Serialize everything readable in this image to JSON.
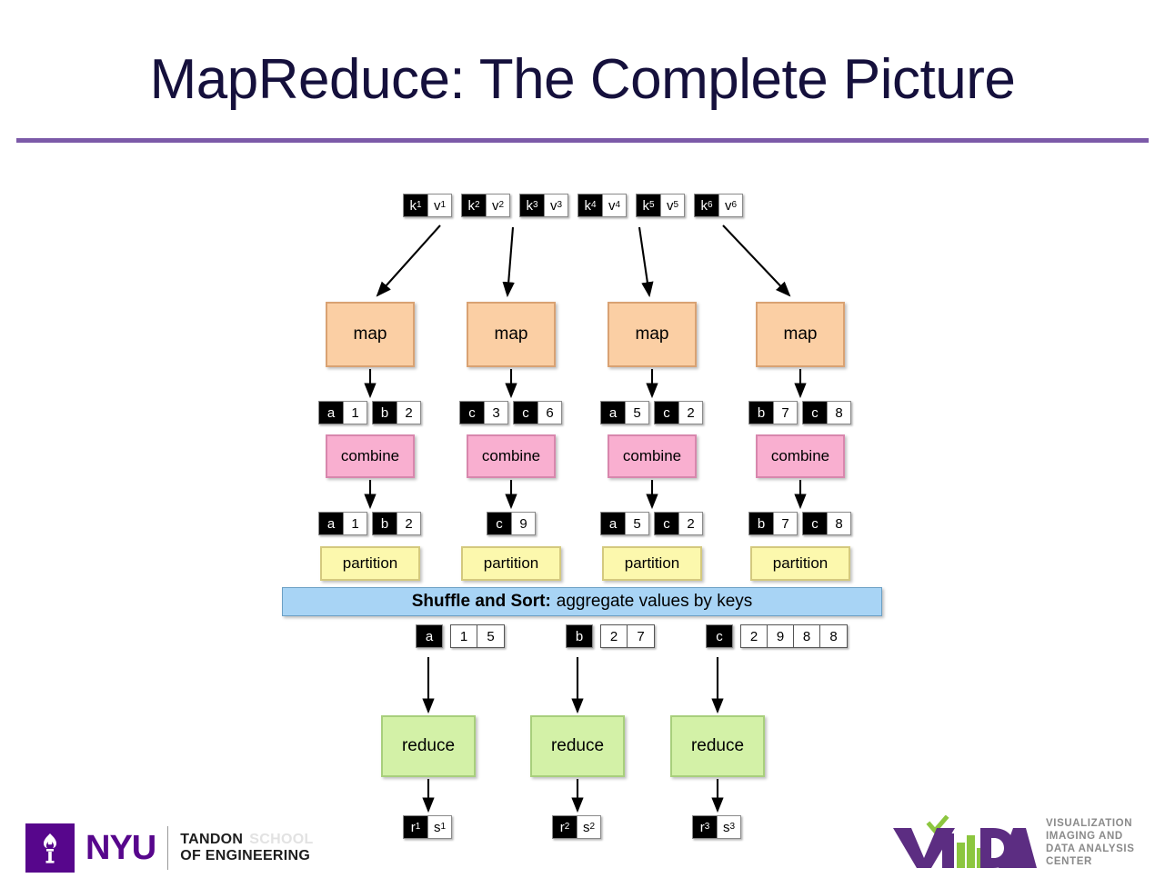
{
  "slide": {
    "title": "MapReduce: The Complete Picture",
    "title_color": "#15103c",
    "rule_color": "#7c5aa8"
  },
  "inputs": [
    {
      "k": "k",
      "ksub": "1",
      "v": "v",
      "vsub": "1"
    },
    {
      "k": "k",
      "ksub": "2",
      "v": "v",
      "vsub": "2"
    },
    {
      "k": "k",
      "ksub": "3",
      "v": "v",
      "vsub": "3"
    },
    {
      "k": "k",
      "ksub": "4",
      "v": "v",
      "vsub": "4"
    },
    {
      "k": "k",
      "ksub": "5",
      "v": "v",
      "vsub": "5"
    },
    {
      "k": "k",
      "ksub": "6",
      "v": "v",
      "vsub": "6"
    }
  ],
  "stages": {
    "map_label": "map",
    "combine_label": "combine",
    "partition_label": "partition",
    "reduce_label": "reduce"
  },
  "map_outputs": [
    [
      {
        "k": "a",
        "v": "1"
      },
      {
        "k": "b",
        "v": "2"
      }
    ],
    [
      {
        "k": "c",
        "v": "3"
      },
      {
        "k": "c",
        "v": "6"
      }
    ],
    [
      {
        "k": "a",
        "v": "5"
      },
      {
        "k": "c",
        "v": "2"
      }
    ],
    [
      {
        "k": "b",
        "v": "7"
      },
      {
        "k": "c",
        "v": "8"
      }
    ]
  ],
  "combine_outputs": [
    [
      {
        "k": "a",
        "v": "1"
      },
      {
        "k": "b",
        "v": "2"
      }
    ],
    [
      {
        "k": "c",
        "v": "9"
      }
    ],
    [
      {
        "k": "a",
        "v": "5"
      },
      {
        "k": "c",
        "v": "2"
      }
    ],
    [
      {
        "k": "b",
        "v": "7"
      },
      {
        "k": "c",
        "v": "8"
      }
    ]
  ],
  "shuffle": {
    "strong": "Shuffle and Sort:",
    "rest": "aggregate values by keys",
    "banner_color": "#a8d4f5"
  },
  "shuffle_outputs": [
    {
      "k": "a",
      "values": [
        "1",
        "5"
      ]
    },
    {
      "k": "b",
      "values": [
        "2",
        "7"
      ]
    },
    {
      "k": "c",
      "values": [
        "2",
        "9",
        "8",
        "8"
      ]
    }
  ],
  "reduce_outputs": [
    {
      "k": "r",
      "ksub": "1",
      "v": "s",
      "vsub": "1"
    },
    {
      "k": "r",
      "ksub": "2",
      "v": "s",
      "vsub": "2"
    },
    {
      "k": "r",
      "ksub": "3",
      "v": "s",
      "vsub": "3"
    }
  ],
  "colors": {
    "map": "#fbcfa4",
    "combine": "#f9afd0",
    "partition": "#fcf8ad",
    "reduce": "#d3f1a7",
    "nyu_purple": "#57068c",
    "vida_purple": "#5c2d82",
    "vida_green": "#8cc63f"
  },
  "nyu_logo": {
    "word": "NYU",
    "tandon": "TANDON",
    "school": "SCHOOL",
    "of_engineering": "OF ENGINEERING"
  },
  "vida_logo": {
    "wordmark": "VIDA",
    "line1": "VISUALIZATION",
    "line2": "IMAGING AND",
    "line3": "DATA ANALYSIS",
    "line4": "CENTER"
  }
}
